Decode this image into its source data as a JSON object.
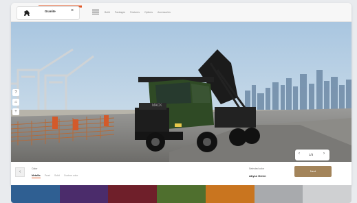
{
  "header": {
    "model_label": "Granite",
    "close_glyph": "×",
    "nav_items": [
      "Build",
      "Packages",
      "Features",
      "Options",
      "Accessories"
    ]
  },
  "hero": {
    "truck_bumper_text": "MACK",
    "pager": {
      "prev": "‹",
      "current": "1/3",
      "next": "›"
    }
  },
  "side_tools": [
    "?",
    "⌂",
    "+"
  ],
  "bottom": {
    "back_glyph": "‹",
    "color_section_title": "Color",
    "color_tabs": [
      "Metallic",
      "Pearl",
      "Solid",
      "Custom color"
    ],
    "active_tab": "Metallic",
    "selected_label": "Selected color",
    "selected_value": "Abyss Green",
    "next_button": "Next"
  },
  "swatches": [
    {
      "name": "blue",
      "color": "#2f5f92"
    },
    {
      "name": "purple",
      "color": "#4b2c6b"
    },
    {
      "name": "maroon",
      "color": "#6f1f2a"
    },
    {
      "name": "olive-green",
      "color": "#4f6f2e"
    },
    {
      "name": "orange",
      "color": "#c9751f"
    },
    {
      "name": "silver",
      "color": "#a8aaad"
    },
    {
      "name": "light-silver",
      "color": "#cfd0d2"
    }
  ],
  "colors": {
    "accent": "#e15a2a",
    "next_button": "#a3845a",
    "truck_cab": "#2f4a25"
  }
}
